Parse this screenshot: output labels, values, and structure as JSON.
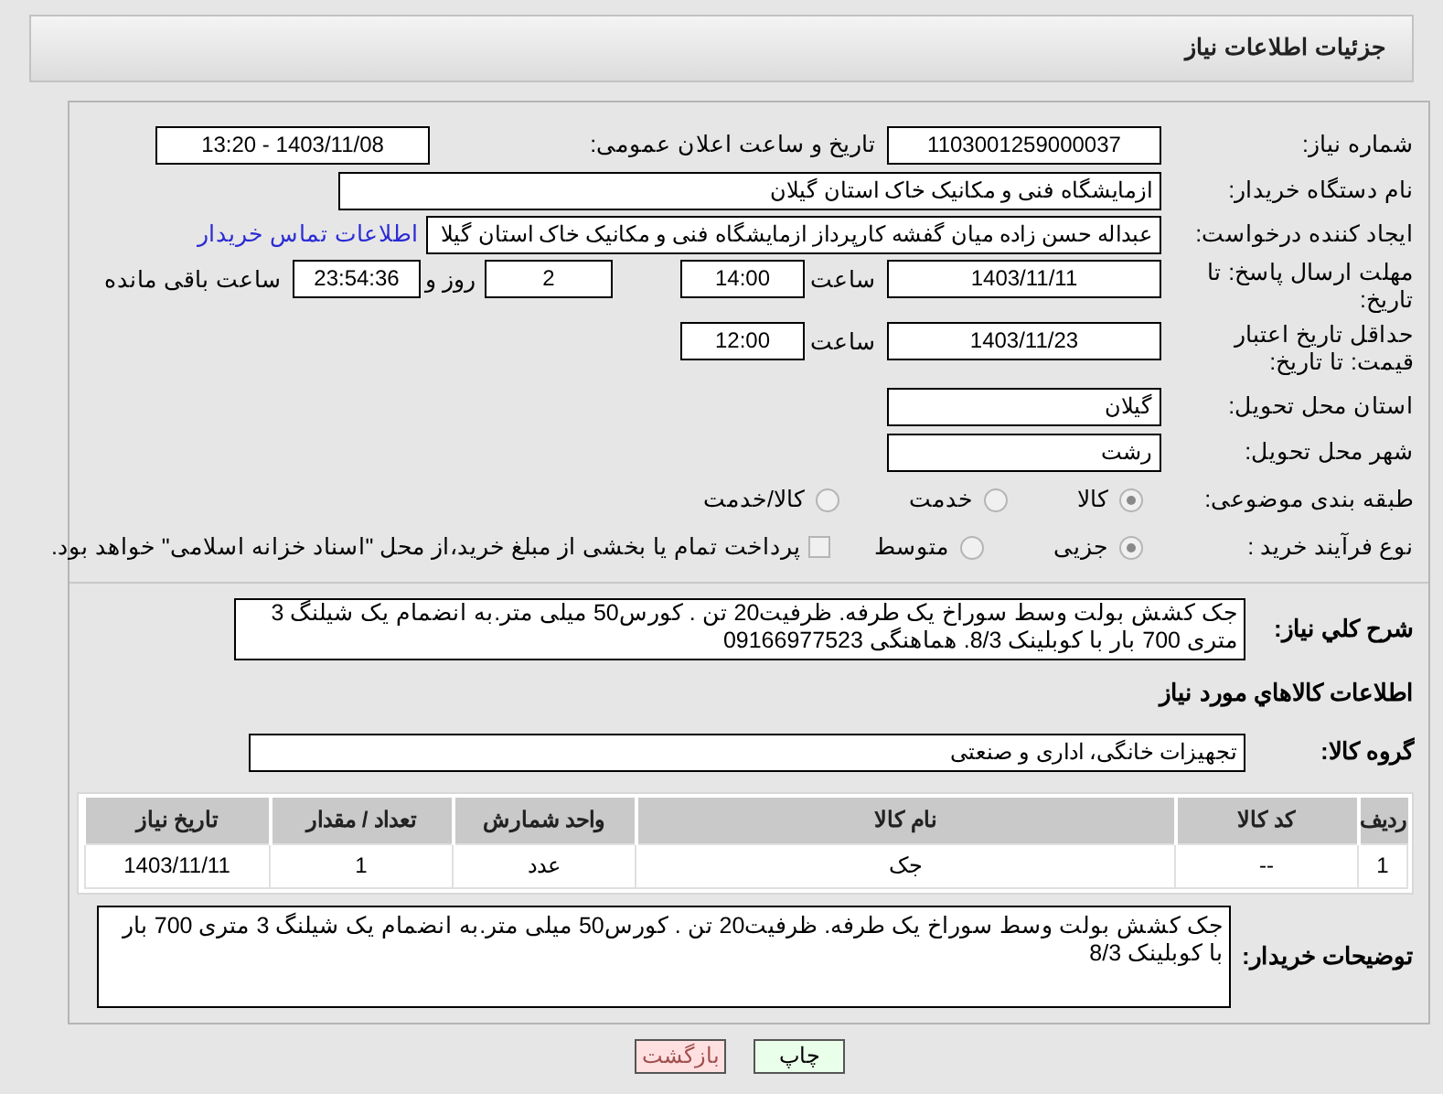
{
  "header": {
    "title": "جزئیات اطلاعات نیاز"
  },
  "fields": {
    "need_number": {
      "label": "شماره نیاز:",
      "value": "1103001259000037"
    },
    "announce": {
      "label": "تاریخ و ساعت اعلان عمومی:",
      "value": "1403/11/08 - 13:20"
    },
    "buyer": {
      "label": "نام دستگاه خریدار:",
      "value": "ازمایشگاه فنی و مکانیک خاک استان گیلان"
    },
    "creator": {
      "label": "ایجاد کننده درخواست:",
      "value": "عبداله حسن زاده میان گفشه کارپرداز ازمایشگاه فنی و مکانیک خاک استان گیلا",
      "link": "اطلاعات تماس خریدار"
    },
    "deadline": {
      "label": "مهلت ارسال پاسخ: تا تاریخ:",
      "date": "1403/11/11",
      "time_label": "ساعت",
      "time": "14:00",
      "days": "2",
      "days_label": "روز و",
      "remaining": "23:54:36",
      "remaining_label": "ساعت باقی مانده"
    },
    "validity": {
      "label": "حداقل تاریخ اعتبار قیمت: تا تاریخ:",
      "date": "1403/11/23",
      "time_label": "ساعت",
      "time": "12:00"
    },
    "province": {
      "label": "استان محل تحویل:",
      "value": "گیلان"
    },
    "city": {
      "label": "شهر محل تحویل:",
      "value": "رشت"
    }
  },
  "category": {
    "label": "طبقه بندی موضوعی:",
    "options": [
      {
        "label": "کالا",
        "selected": true
      },
      {
        "label": "خدمت",
        "selected": false
      },
      {
        "label": "کالا/خدمت",
        "selected": false
      }
    ]
  },
  "process": {
    "label": "نوع فرآیند خرید :",
    "options": [
      {
        "label": "جزیی",
        "selected": true
      },
      {
        "label": "متوسط",
        "selected": false
      }
    ],
    "treasury": {
      "checked": false,
      "label": "پرداخت تمام یا بخشی از مبلغ خرید،از محل \"اسناد خزانه اسلامی\" خواهد بود."
    }
  },
  "description": {
    "label": "شرح کلي نياز:",
    "value": "جک کشش بولت وسط سوراخ یک طرفه.  ظرفیت20 تن . کورس50 میلی متر.به انضمام یک شیلنگ 3 متری 700 بار با کوبلینک 8/3. هماهنگی 09166977523"
  },
  "goods_heading": "اطلاعات کالاهاي مورد نياز",
  "goods_group": {
    "label": "گروه کالا:",
    "value": "تجهیزات خانگی، اداری و صنعتی"
  },
  "table": {
    "columns": [
      "ردیف",
      "کد کالا",
      "نام کالا",
      "واحد شمارش",
      "تعداد / مقدار",
      "تاریخ نیاز"
    ],
    "rows": [
      [
        "1",
        "--",
        "جک",
        "عدد",
        "1",
        "1403/11/11"
      ]
    ]
  },
  "buyer_notes": {
    "label": "توضیحات خریدار:",
    "value": "جک کشش بولت وسط سوراخ یک طرفه.  ظرفیت20 تن . کورس50 میلی متر.به انضمام یک شیلنگ 3 متری 700 بار با کوبلینک 8/3"
  },
  "buttons": [
    {
      "label": "چاپ",
      "kind": "print"
    },
    {
      "label": "بازگشت",
      "kind": "back"
    }
  ]
}
